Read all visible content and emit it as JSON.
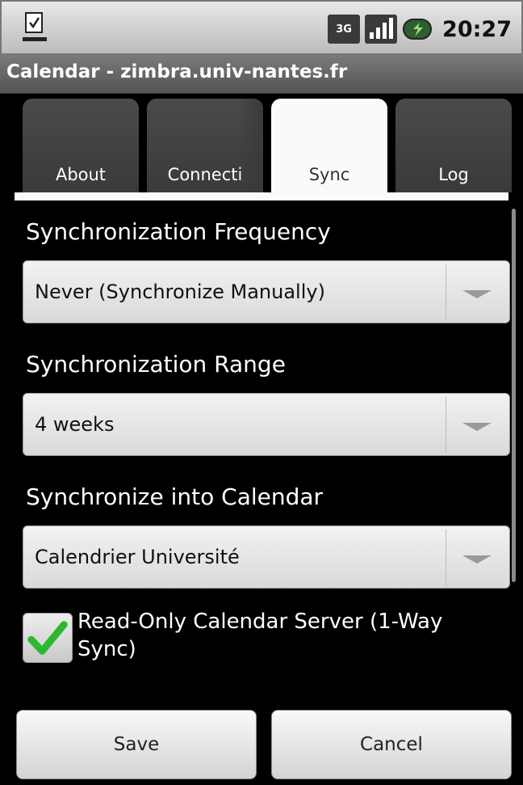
{
  "status_bar": {
    "network_label": "3G",
    "time": "20:27",
    "icons": [
      "download-complete-icon",
      "3g-icon",
      "signal-icon",
      "battery-icon"
    ]
  },
  "window": {
    "title": "Calendar - zimbra.univ-nantes.fr"
  },
  "tabs": [
    {
      "label": "About",
      "active": false
    },
    {
      "label": "Connecti",
      "active": false
    },
    {
      "label": "Sync",
      "active": true
    },
    {
      "label": "Log",
      "active": false
    }
  ],
  "sync": {
    "frequency": {
      "label": "Synchronization Frequency",
      "value": "Never (Synchronize Manually)"
    },
    "range": {
      "label": "Synchronization Range",
      "value": "4 weeks"
    },
    "calendar": {
      "label": "Synchronize into Calendar",
      "value": "Calendrier Université"
    },
    "read_only": {
      "label": "Read-Only Calendar Server (1-Way Sync)",
      "checked": true
    }
  },
  "buttons": {
    "save": "Save",
    "cancel": "Cancel"
  },
  "colors": {
    "background": "#000000",
    "check_green": "#2db82d",
    "tab_active": "#fafafa",
    "tab_inactive": "#404040"
  }
}
